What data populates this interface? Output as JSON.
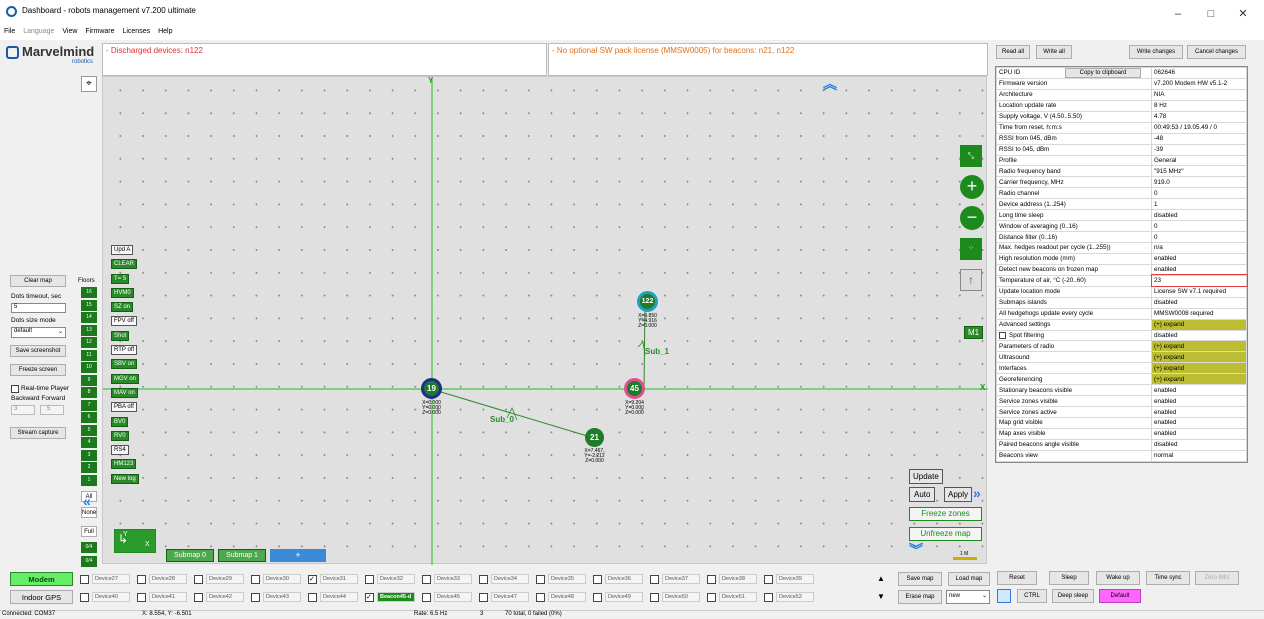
{
  "window": {
    "title": "Dashboard - robots management  v7.200  ultimate",
    "min": "–",
    "max": "□",
    "close": "✕"
  },
  "menu": [
    "File",
    "Language",
    "View",
    "Firmware",
    "Licenses",
    "Help"
  ],
  "logo": {
    "brand": "Marvelmind",
    "sub": "robotics"
  },
  "alerts": {
    "left": "- Discharged devices: n122",
    "right": "- No optional SW pack license (MMSW0005) for beacons: n21, n122"
  },
  "left_panel": {
    "clear_map": "Clear map",
    "dots_timeout_label": "Dots timeout, sec",
    "dots_timeout_value": "5",
    "dots_size_label": "Dots size mode",
    "dots_size_value": "default",
    "save_screenshot": "Save screenshot",
    "freeze_screen": "Freeze screen",
    "realtime_player": "Real-time Player",
    "backward_forward": "Backward Forward",
    "bf_a": "3",
    "bf_b": "5",
    "stream_capture": "Stream capture"
  },
  "floors": {
    "label": "Floors",
    "items": [
      "16",
      "15",
      "14",
      "13",
      "12",
      "11",
      "10",
      "9",
      "8",
      "7",
      "6",
      "5",
      "4",
      "3",
      "2",
      "1"
    ],
    "all": "All",
    "none": "None",
    "full": "Full",
    "z1": "0/4",
    "z2": "0/4"
  },
  "map_buttons": [
    "Upd A",
    "CLEAR",
    "T= 5",
    "HVM0",
    "SZ on",
    "FPV off",
    "Shot",
    "RTP off",
    "SBV on",
    "MGV on",
    "MAV on",
    "PBA off",
    "BV0",
    "RV0",
    "RS4",
    "HM123",
    "New log"
  ],
  "map": {
    "beacons": [
      {
        "id": "19",
        "coords": [
          "X=0.000",
          "Y=0.000",
          "Z=0.000"
        ]
      },
      {
        "id": "45",
        "coords": [
          "X=9.204",
          "Y=0.000",
          "Z=0.000"
        ]
      },
      {
        "id": "21",
        "coords": [
          "X=7.467,",
          "Y=-2.212",
          "Z=0.000"
        ]
      },
      {
        "id": "122",
        "coords": [
          "X=9.850",
          "Y=4.916",
          "Z=0.000"
        ]
      }
    ],
    "sub0": "Sub_0",
    "sub1": "Sub_1",
    "axis_y": "Y",
    "axis_x": "X",
    "m1": "M1",
    "update": "Update",
    "auto": "Auto",
    "apply": "Apply",
    "freeze_zones": "Freeze zones",
    "unfreeze_map": "Unfreeze map",
    "scale": "1 M",
    "submaps": [
      "Submap 0",
      "Submap 1",
      "+"
    ]
  },
  "right_top": {
    "read_all": "Read all",
    "write_all": "Write all",
    "write_changes": "Write changes",
    "cancel_changes": "Cancel changes",
    "copy": "Copy to clipboard"
  },
  "properties": [
    [
      "CPU ID",
      "062646"
    ],
    [
      "Firmware version",
      "v7.200 Modem HW v5.1-2"
    ],
    [
      "Architecture",
      "NIA"
    ],
    [
      "Location update rate",
      "8 Hz"
    ],
    [
      "Supply voltage, V (4.50..5.50)",
      "4.78"
    ],
    [
      "Time from reset, h:m:s",
      "00:49:53 / 19.05.49 / 0"
    ],
    [
      "RSSI from 045, dBm",
      "-48"
    ],
    [
      "RSSI to 045, dBm",
      "-39"
    ],
    [
      "Profile",
      "General"
    ],
    [
      "Radio frequency band",
      "\"915 MHz\""
    ],
    [
      "Carrier frequency, MHz",
      "919.0"
    ],
    [
      "Radio channel",
      "0"
    ],
    [
      "Device address (1..254)",
      "1"
    ],
    [
      "Long time sleep",
      "disabled"
    ],
    [
      "Window of averaging (0..16)",
      "0"
    ],
    [
      "Distance filter (0..16)",
      "0"
    ],
    [
      "Max. hedges readout per cycle (1..255))",
      "n/a"
    ],
    [
      "High resolution mode (mm)",
      "enabled"
    ],
    [
      "Detect new beacons on frozen map",
      "enabled"
    ],
    [
      "Temperature of air, °C (-20..60)",
      "23"
    ],
    [
      "Update location mode",
      "License SW v7.1 required"
    ],
    [
      "Submaps islands",
      "disabled"
    ],
    [
      "All hedgehogs update every cycle",
      "MMSW0008 required"
    ],
    [
      "Advanced settings",
      "(+) expand"
    ],
    [
      "Spot filtering",
      "disabled"
    ],
    [
      "Parameters of radio",
      "(+) expand"
    ],
    [
      "Ultrasound",
      "(+) expand"
    ],
    [
      "Interfaces",
      "(+) expand"
    ],
    [
      "Georeferencing",
      "(+) expand"
    ],
    [
      "Stationary beacons visible",
      "enabled"
    ],
    [
      "Service zones visible",
      "enabled"
    ],
    [
      "Service zones active",
      "enabled"
    ],
    [
      "Map grid visible",
      "enabled"
    ],
    [
      "Map axes visible",
      "enabled"
    ],
    [
      "Paired beacons angle visible",
      "disabled"
    ],
    [
      "Beacons view",
      "normal"
    ]
  ],
  "bottom": {
    "modem": "Modem",
    "indoor_gps": "Indoor GPS",
    "row1": [
      "Device27",
      "Device28",
      "Device29",
      "Device30",
      "Device31",
      "Device32",
      "Device33",
      "Device34",
      "Device35",
      "Device36",
      "Device37",
      "Device38",
      "Device39"
    ],
    "row2": [
      "Device40",
      "Device41",
      "Device42",
      "Device43",
      "Device44",
      "Beacon45-d",
      "Device45",
      "Device47",
      "Device48",
      "Device49",
      "Device50",
      "Device51",
      "Device52"
    ],
    "save_map": "Save map",
    "load_map": "Load map",
    "erase_map": "Erase map",
    "new": "new",
    "reset": "Reset",
    "sleep": "Sleep",
    "wake_up": "Wake up",
    "time_sync": "Time sync",
    "zero_imu": "Zero IMU",
    "ctrl": "CTRL",
    "deep_sleep": "Deep sleep",
    "default": "Default"
  },
  "status": {
    "connected": "Connected: COM37",
    "xy": "X: 8.554, Y: -6.501",
    "rate": "Rate: 6.5 Hz",
    "n": "3",
    "total": "70 total, 0 failed (0%)"
  }
}
